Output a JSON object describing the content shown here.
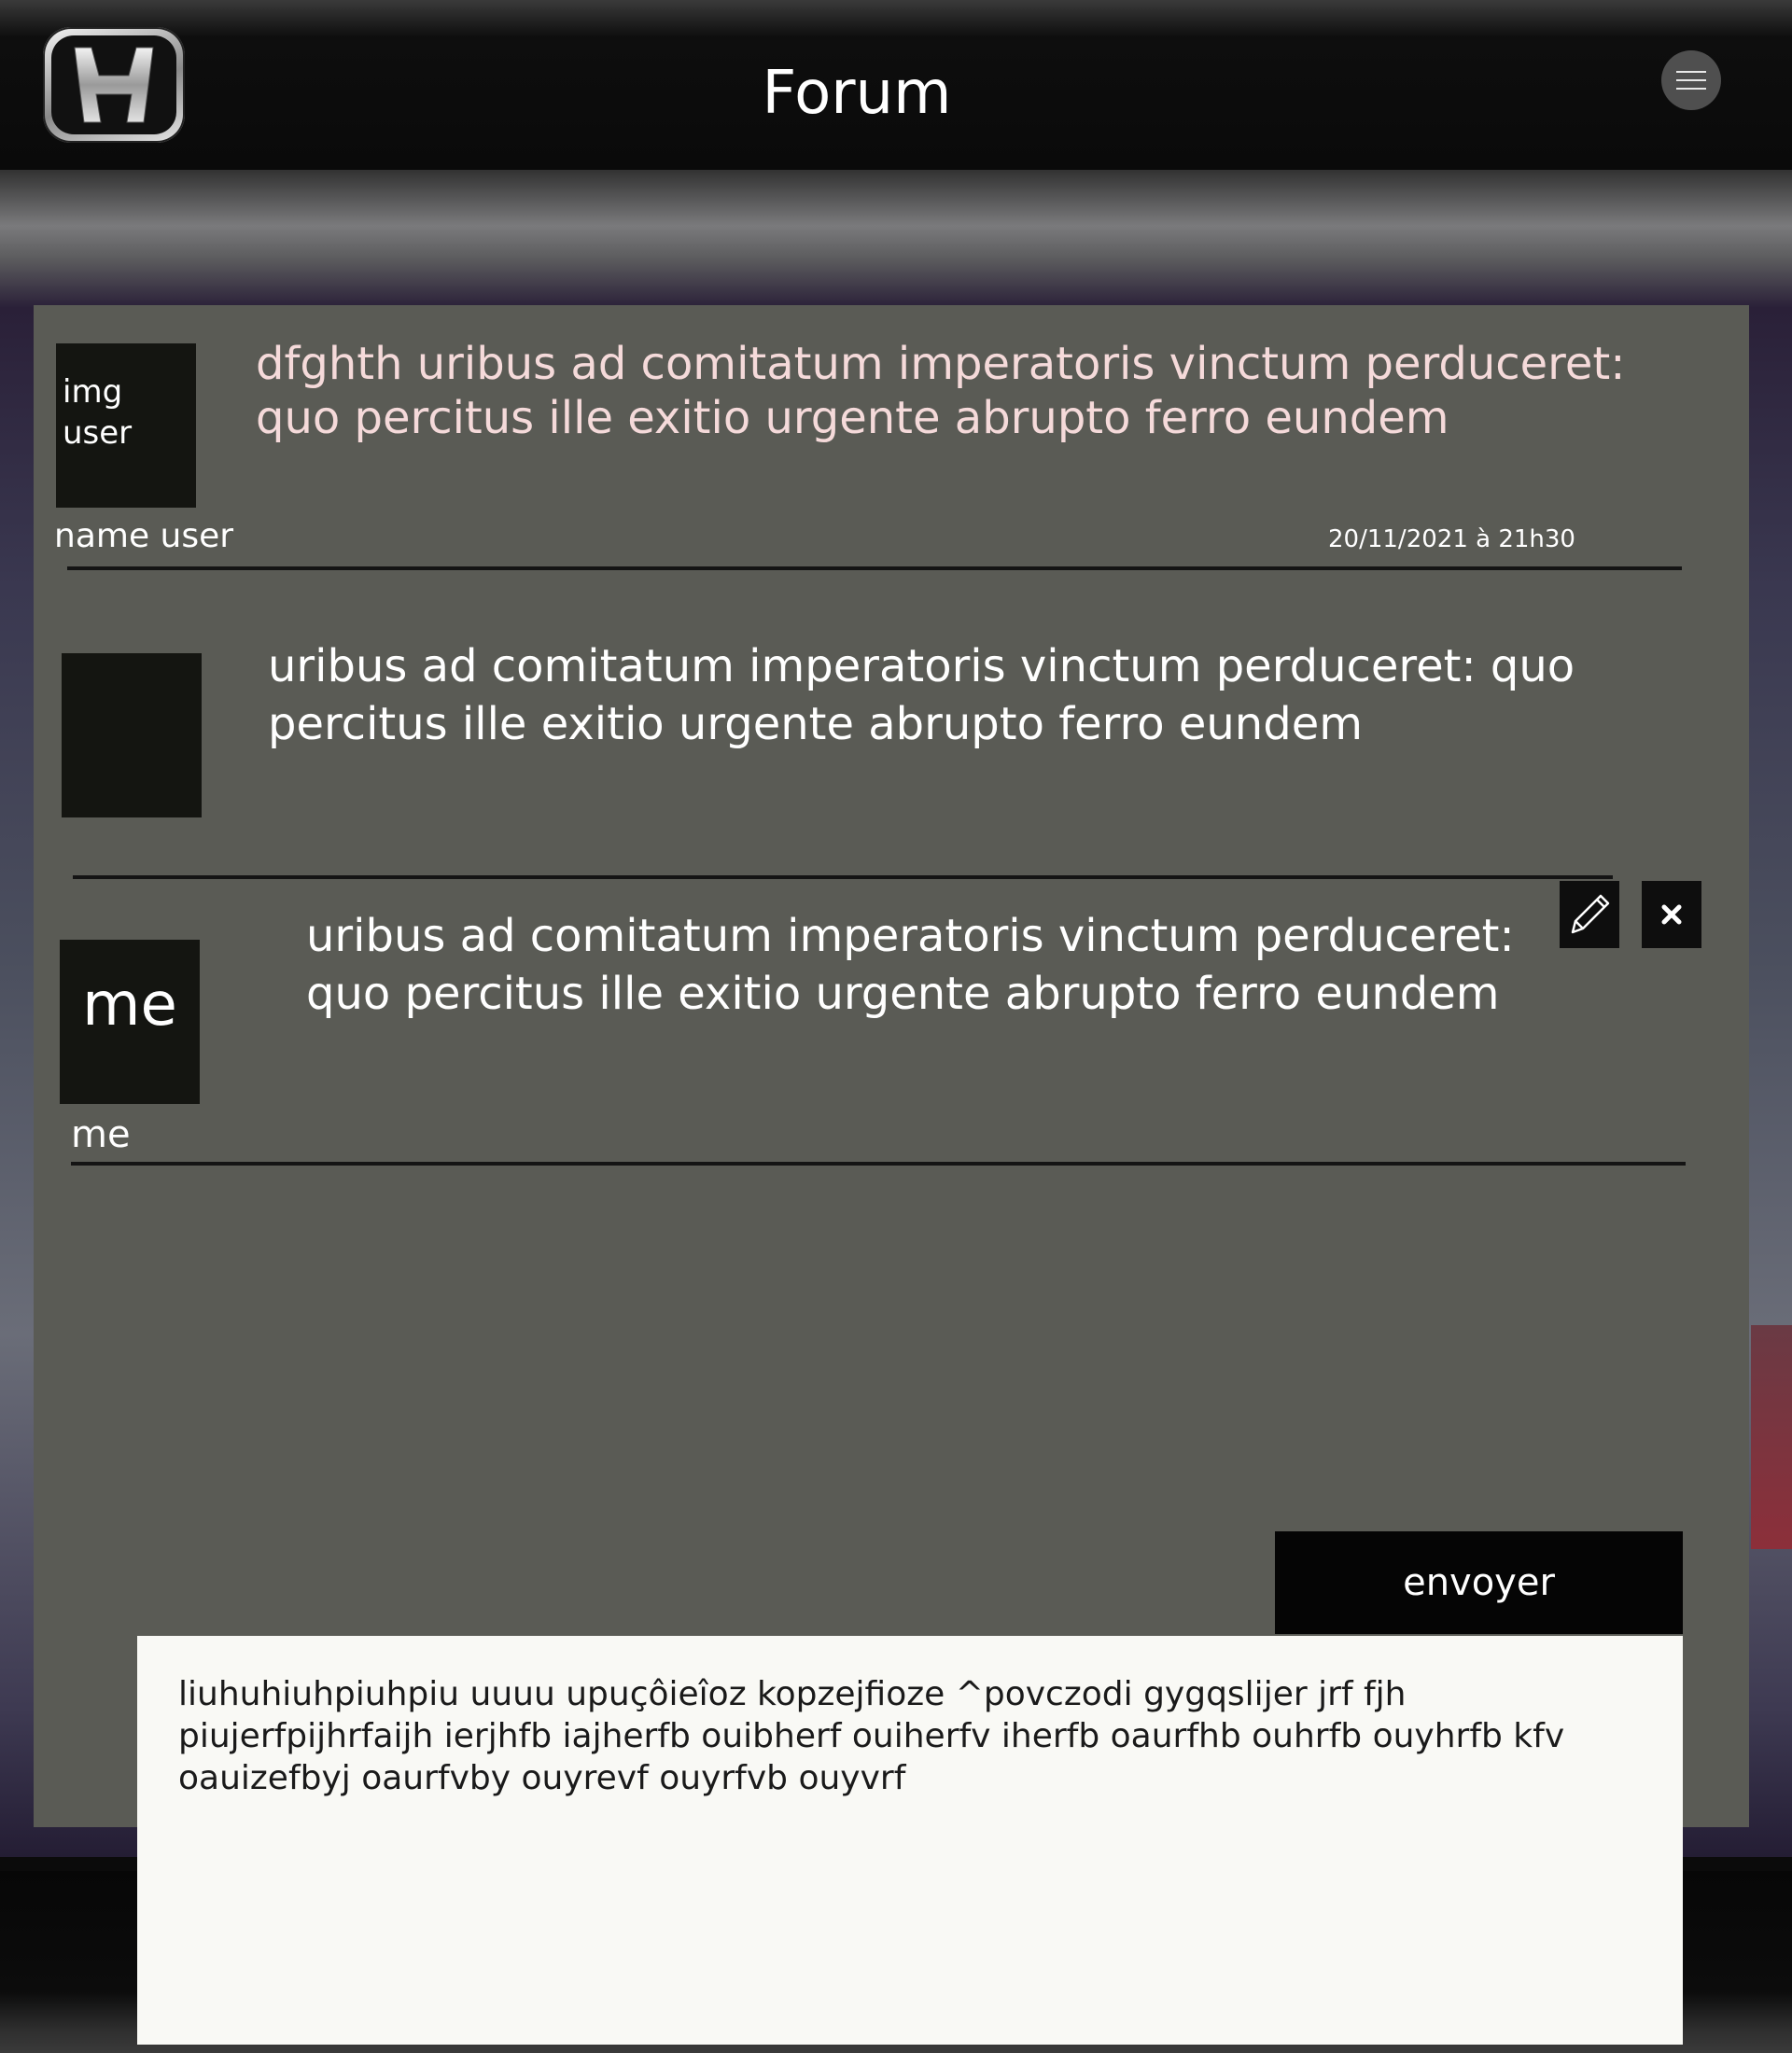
{
  "header": {
    "title": "Forum",
    "brand_logo": "honda-h-logo",
    "menu_icon": "hamburger-icon"
  },
  "posts": [
    {
      "avatar_text": "img\nuser",
      "text": "dfghth uribus ad comitatum imperatoris vinctum perduceret: quo percitus ille exitio urgente abrupto ferro eundem",
      "author": "name user",
      "timestamp": "20/11/2021 à 21h30"
    },
    {
      "avatar_text": "",
      "text": "uribus ad comitatum imperatoris vinctum perduceret: quo percitus ille exitio urgente abrupto ferro eundem"
    },
    {
      "avatar_text": "me",
      "text": "uribus ad comitatum imperatoris vinctum perduceret: quo percitus ille exitio urgente abrupto ferro eundem",
      "author": "me",
      "edit_icon": "pencil-icon",
      "delete_icon": "close-icon"
    }
  ],
  "composer": {
    "send_label": "envoyer",
    "value": "liuhuhiuhpiuhpiu uuuu upuçôieîoz kopzejfioze ^povczodi gygqslijer jrf fjh piujerfpijhrfaijh ierjhfb iajherfb ouibherf ouiherfv iherfb oaurfhb ouhrfb ouyhrfb kfv oauizefbyj oaurfvby ouyrevf ouyrfvb ouyvrf"
  },
  "colors": {
    "panel": "#5a5b55",
    "post1_text": "#f5dada",
    "post_text": "#ffffff",
    "avatar": "#141511"
  }
}
